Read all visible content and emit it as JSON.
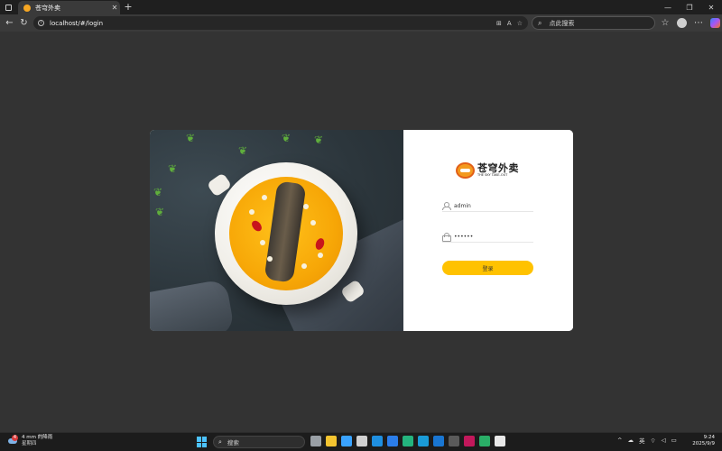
{
  "browser": {
    "tab_title": "苍穹外卖",
    "tab_close": "✕",
    "new_tab": "+",
    "window_controls": {
      "minimize": "—",
      "restore": "❐",
      "close": "✕"
    },
    "url": "localhost/#/login",
    "search_placeholder": "点此搜索",
    "icons": [
      "sidebar-icon",
      "back-icon",
      "reload-icon",
      "info-icon",
      "split-screen-icon",
      "read-aloud-icon",
      "favorite-icon",
      "search-icon",
      "favorites-icon",
      "profile-icon",
      "more-icon",
      "copilot-icon"
    ]
  },
  "login": {
    "logo_cn": "苍穹外卖",
    "logo_en": "THE SKY TAKE-OUT",
    "username_value": "admin",
    "password_value": "••••••",
    "submit_label": "登录"
  },
  "taskbar": {
    "weather_line1": "4 mm 的降雨",
    "weather_line2": "星期四",
    "weather_badge": "4",
    "search_label": "搜索",
    "input_method": "英",
    "time": "9:24",
    "date": "2025/9/9",
    "app_colors": [
      "#9aa0a6",
      "#f4c430",
      "#3aa3ff",
      "#d0d0d0",
      "#1f8fe0",
      "#2b7de9",
      "#24b47e",
      "#1a9bd7",
      "#1976d2",
      "#5a5a5a",
      "#c2185b",
      "#2aae67",
      "#e8e8e8"
    ]
  },
  "colors": {
    "accent_button": "#ffc200",
    "page_background": "#333333"
  }
}
